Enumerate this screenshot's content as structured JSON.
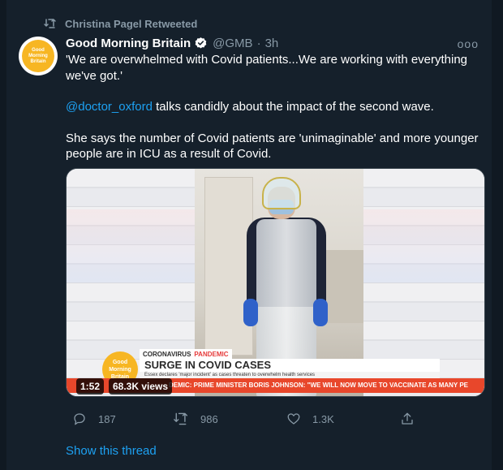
{
  "retweet": {
    "label": "Christina Pagel Retweeted",
    "icon": "retweet-icon"
  },
  "author": {
    "display_name": "Good Morning Britain",
    "handle": "@GMB",
    "separator": "·",
    "time": "3h",
    "verified": true,
    "avatar_text": [
      "Good",
      "Morning",
      "Britain"
    ]
  },
  "more_label": "ooo",
  "tweet": {
    "line1": "'We are overwhelmed with Covid patients...We are working with everything we've got.'",
    "mention": "@doctor_oxford",
    "line2_rest": " talks candidly about the impact of the second wave.",
    "line3": "She says the number of Covid patients are 'unimaginable' and more younger people are in ICU as a result of Covid."
  },
  "video": {
    "bug_text": [
      "Good",
      "Morning",
      "Britain"
    ],
    "tag_prefix": "CORONAVIRUS",
    "tag_accent": "PANDEMIC",
    "headline": "SURGE IN COVID CASES",
    "subline": "Essex declares 'major incident' as cases threaten to overwhelm health services",
    "ticker": "DEMIC: PRIME MINISTER BORIS JOHNSON: \"WE WILL NOW MOVE TO VACCINATE AS MANY PE",
    "duration": "1:52",
    "views": "68.3K views"
  },
  "actions": {
    "reply_count": "187",
    "retweet_count": "986",
    "like_count": "1.3K"
  },
  "show_thread": "Show this thread",
  "colors": {
    "background": "#15202b",
    "accent": "#1da1f2",
    "muted": "#8899a6",
    "gmb_yellow": "#f7b623"
  }
}
